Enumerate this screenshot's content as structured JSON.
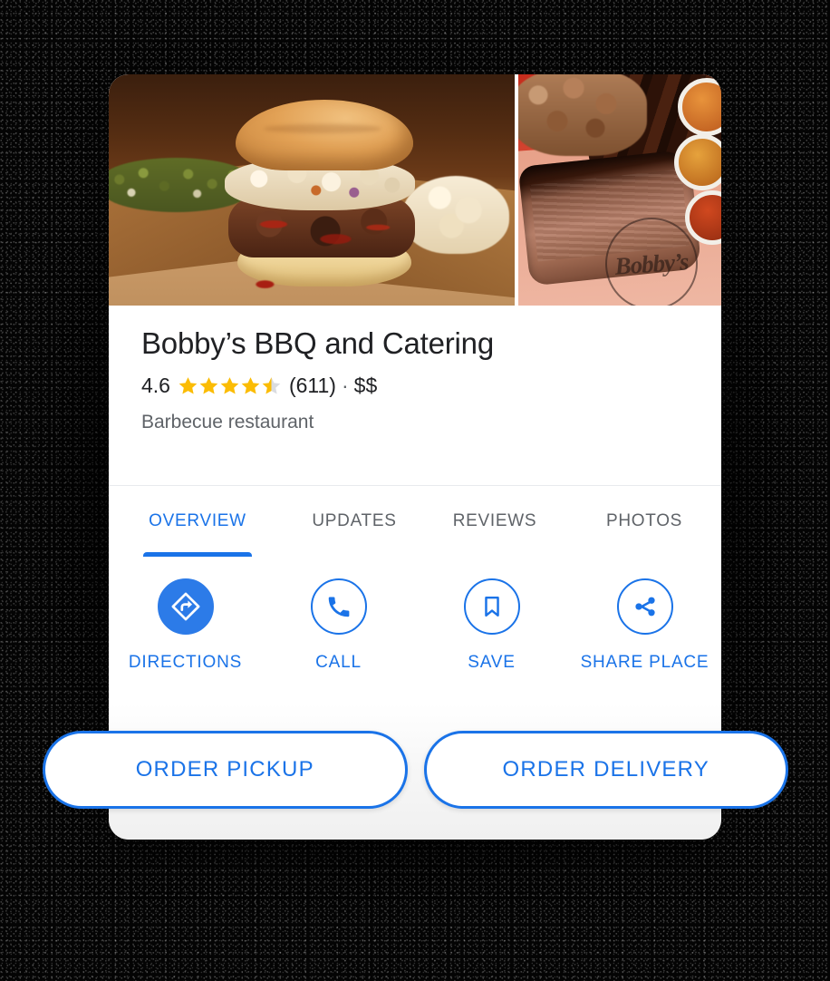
{
  "place": {
    "name": "Bobby’s BBQ and Catering",
    "rating_value": "4.6",
    "rating_stars": 4.5,
    "review_count": "(611)",
    "meta_separator": "·",
    "price_level": "$$",
    "category": "Barbecue restaurant",
    "photo_watermark": "Bobby’s"
  },
  "colors": {
    "accent_blue": "#1a73e8",
    "star_gold": "#fbbc04",
    "star_empty": "#dadce0",
    "text_primary": "#202124",
    "text_secondary": "#5f6368"
  },
  "tabs": [
    {
      "label": "OVERVIEW",
      "active": true
    },
    {
      "label": "UPDATES",
      "active": false
    },
    {
      "label": "REVIEWS",
      "active": false
    },
    {
      "label": "PHOTOS",
      "active": false
    }
  ],
  "actions": [
    {
      "label": "DIRECTIONS",
      "icon": "directions-icon",
      "style": "filled"
    },
    {
      "label": "CALL",
      "icon": "phone-icon",
      "style": "outlined"
    },
    {
      "label": "SAVE",
      "icon": "bookmark-icon",
      "style": "outlined"
    },
    {
      "label": "SHARE PLACE",
      "icon": "share-icon",
      "style": "outlined"
    }
  ],
  "order_buttons": [
    {
      "label": "ORDER PICKUP"
    },
    {
      "label": "ORDER DELIVERY"
    }
  ]
}
